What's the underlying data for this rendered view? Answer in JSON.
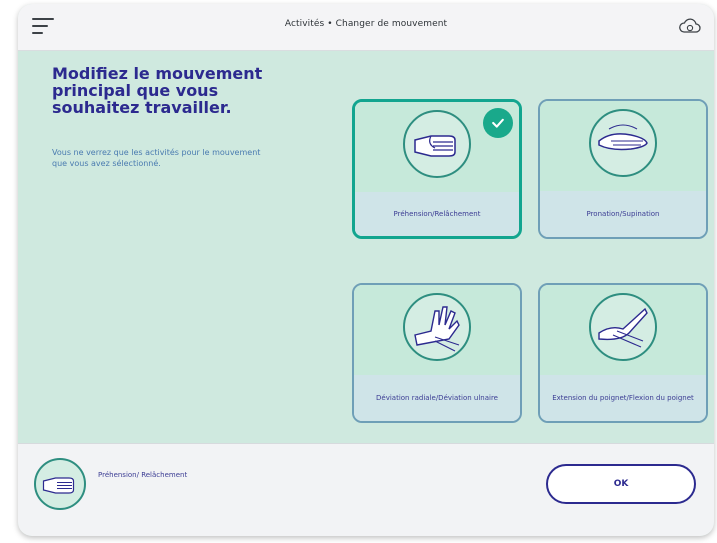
{
  "header": {
    "title": "Activités • Changer de mouvement",
    "menu_icon": "menu-icon",
    "cloud_icon": "cloud-sync-icon"
  },
  "intro": {
    "heading": "Modifiez le mouvement principal que vous souhaitez travailler.",
    "description": "Vous ne verrez que les activités pour le mouvement que vous avez sélectionné."
  },
  "movements": [
    {
      "label": "Préhension/Relâchement",
      "icon": "hand-grasp-icon",
      "selected": true
    },
    {
      "label": "Pronation/Supination",
      "icon": "hand-rotate-icon",
      "selected": false
    },
    {
      "label": "Déviation radiale/Déviation ulnaire",
      "icon": "hand-deviation-icon",
      "selected": false
    },
    {
      "label": "Extension du poignet/Flexion du poignet",
      "icon": "wrist-flex-icon",
      "selected": false
    }
  ],
  "footer": {
    "selected_label": "Préhension/ Relâchement",
    "selected_icon": "hand-grasp-icon",
    "ok_label": "OK"
  },
  "colors": {
    "accent": "#2c2a8f",
    "selected_border": "#12a58f",
    "background": "#cfe9df"
  }
}
